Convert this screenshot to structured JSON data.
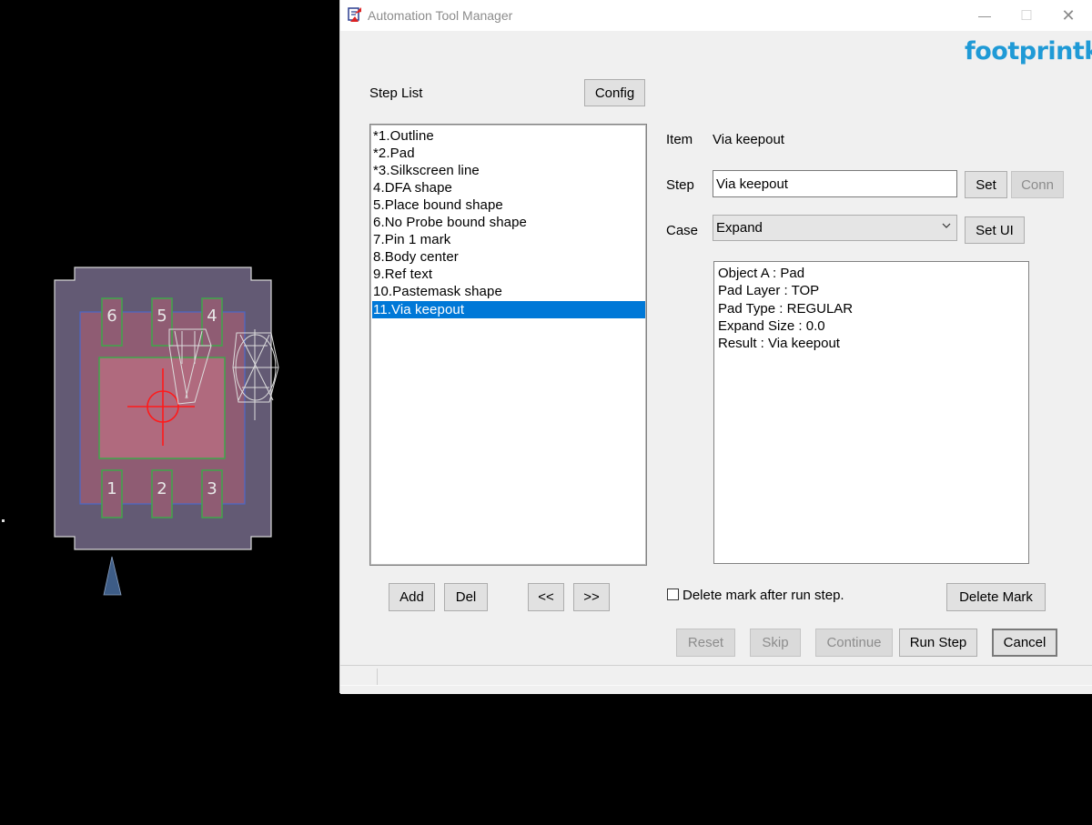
{
  "window": {
    "title": "Automation Tool Manager",
    "minimize": "—",
    "maximize": "☐",
    "close": "✕"
  },
  "logo": "footprintku",
  "step_list": {
    "label": "Step List",
    "config": "Config",
    "items": [
      "*1.Outline",
      "*2.Pad",
      "*3.Silkscreen line",
      "4.DFA shape",
      "5.Place bound shape",
      "6.No Probe bound shape",
      "7.Pin 1 mark",
      "8.Body center",
      "9.Ref text",
      "10.Pastemask shape",
      "11.Via keepout"
    ],
    "selected_index": 10
  },
  "item": {
    "label": "Item",
    "value": "Via keepout"
  },
  "step": {
    "label": "Step",
    "value": "Via keepout",
    "set": "Set",
    "conn": "Conn"
  },
  "case": {
    "label": "Case",
    "value": "Expand",
    "set_ui": "Set UI"
  },
  "details": [
    "Object A : Pad",
    "Pad Layer : TOP",
    "Pad Type : REGULAR",
    "Expand Size : 0.0",
    "Result : Via keepout"
  ],
  "list_buttons": {
    "add": "Add",
    "del": "Del",
    "prev": "<<",
    "next": ">>"
  },
  "delete_mark_checkbox": {
    "label": "Delete mark after run step.",
    "checked": false
  },
  "delete_mark": "Delete Mark",
  "footer_buttons": {
    "reset": "Reset",
    "skip": "Skip",
    "continue": "Continue",
    "run_step": "Run Step",
    "cancel": "Cancel"
  },
  "cad": {
    "pin_labels": [
      "6",
      "5",
      "4",
      "1",
      "2",
      "3"
    ]
  },
  "colors": {
    "accent": "#0078d7",
    "logo": "#1f9ad6",
    "disabled_text": "#8c8c8c"
  }
}
